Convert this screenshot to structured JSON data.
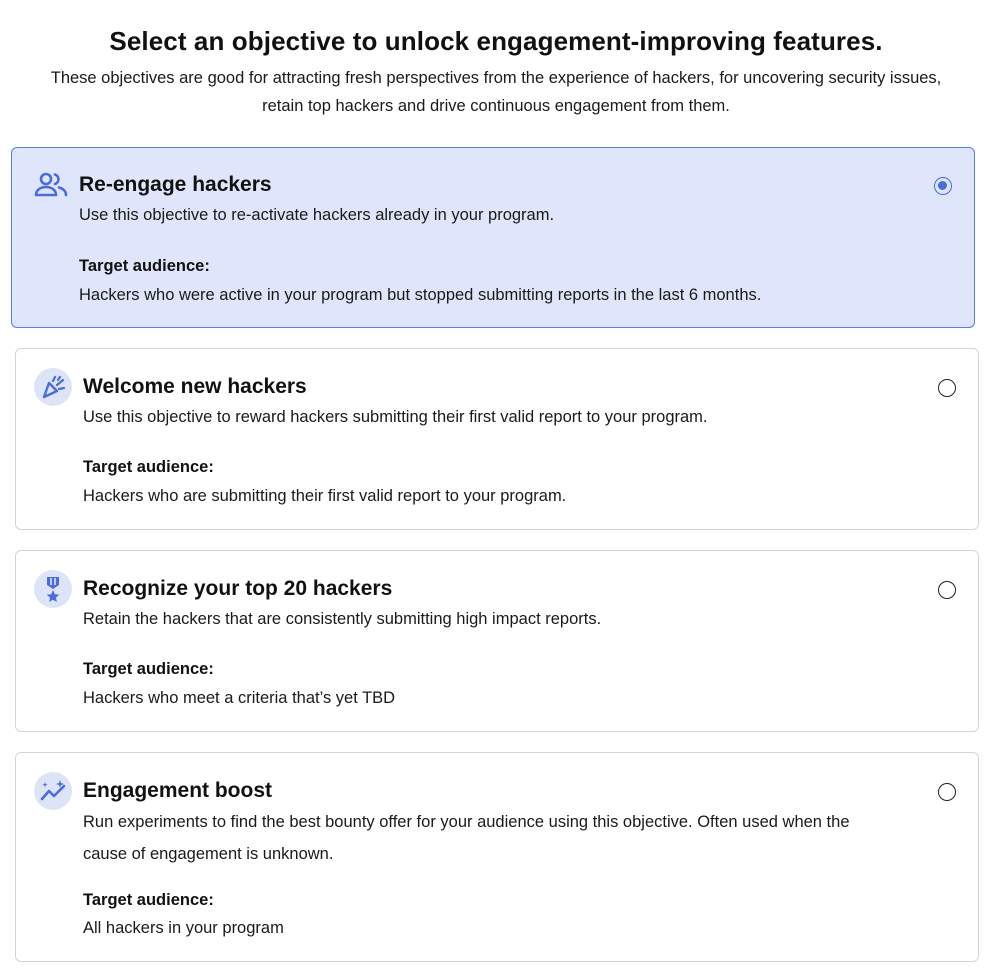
{
  "header": {
    "title": "Select an objective to unlock engagement-improving features.",
    "subtitle": "These objectives are good for attracting fresh perspectives from the experience of hackers, for uncovering security issues, retain top hackers and drive continuous engagement from them."
  },
  "accent_color": "#4a6cdd",
  "selected_bg": "#dfe6fb",
  "objectives": [
    {
      "icon": "users-icon",
      "title": "Re-engage hackers",
      "description": "Use this objective to re-activate hackers already in your program.",
      "audience_label": "Target audience:",
      "audience": "Hackers who were active in your program but stopped submitting reports in the last 6 months.",
      "selected": true
    },
    {
      "icon": "party-popper-icon",
      "title": "Welcome new hackers",
      "description": "Use this objective to reward hackers submitting their first valid report to your program.",
      "audience_label": "Target audience:",
      "audience": "Hackers who are submitting their first valid report to your program.",
      "selected": false
    },
    {
      "icon": "medal-icon",
      "title": "Recognize your top 20 hackers",
      "description": "Retain the hackers that are consistently submitting high impact reports.",
      "audience_label": "Target audience:",
      "audience": "Hackers who meet a criteria that’s yet TBD",
      "selected": false
    },
    {
      "icon": "trend-sparkle-icon",
      "title": "Engagement boost",
      "description": "Run experiments to find the best bounty offer for your audience using this objective. Often used when the cause of engagement is unknown.",
      "audience_label": "Target audience:",
      "audience": "All hackers in your program",
      "selected": false
    }
  ]
}
